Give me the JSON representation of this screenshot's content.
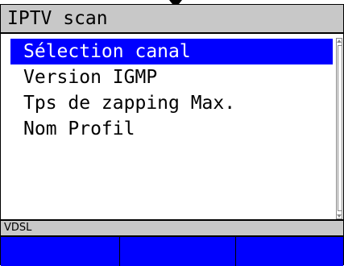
{
  "title": "IPTV scan",
  "menu": {
    "items": [
      {
        "label": "Sélection canal",
        "selected": true
      },
      {
        "label": "Version IGMP",
        "selected": false
      },
      {
        "label": "Tps de zapping Max.",
        "selected": false
      },
      {
        "label": "Nom Profil",
        "selected": false
      }
    ]
  },
  "status": {
    "text": "VDSL"
  },
  "softkeys": [
    {
      "label": ""
    },
    {
      "label": ""
    },
    {
      "label": ""
    }
  ],
  "colors": {
    "selection": "#0000ff",
    "softkey_bar": "#0000ff",
    "title_bar": "#c8c8c8",
    "status_bar": "#c8c8c8"
  }
}
